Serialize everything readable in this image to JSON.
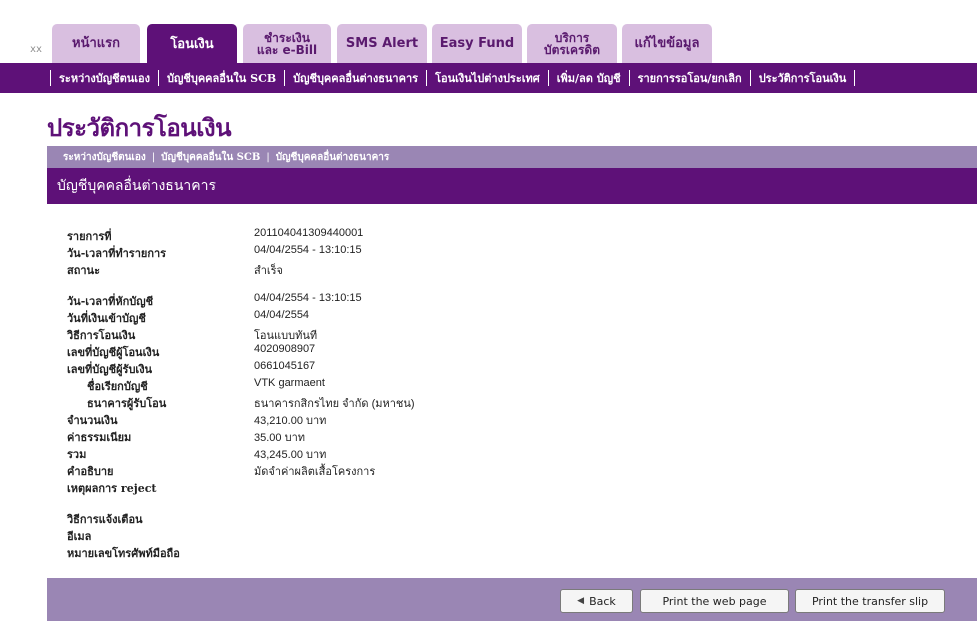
{
  "top_tabs": [
    {
      "label": "หน้าแรก"
    },
    {
      "label": "โอนเงิน"
    },
    {
      "label_line1": "ชำระเงิน",
      "label_line2": "และ e-Bill"
    },
    {
      "label": "SMS Alert"
    },
    {
      "label": "Easy Fund"
    },
    {
      "label_line1": "บริการ",
      "label_line2": "บัตรเครดิต"
    },
    {
      "label": "แก้ไขข้อมูล"
    }
  ],
  "top_left_marker": "xx",
  "submenu": [
    "ระหว่างบัญชีตนเอง",
    "บัญชีบุคคลอื่นใน SCB",
    "บัญชีบุคคลอื่นต่างธนาคาร",
    "โอนเงินไปต่างประเทศ",
    "เพิ่ม/ลด บัญชี",
    "รายการรอโอน/ยกเลิก",
    "ประวัติการโอนเงิน"
  ],
  "page_title": "ประวัติการโอนเงิน",
  "subnav": [
    "ระหว่างบัญชีตนเอง",
    "บัญชีบุคคลอื่นใน SCB",
    "บัญชีบุคคลอื่นต่างธนาคาร"
  ],
  "section_title": "บัญชีบุคคลอื่นต่างธนาคาร",
  "details": {
    "ref_label": "รายการที่",
    "ref_value": "201104041309440001",
    "txn_time_label": "วัน-เวลาที่ทำรายการ",
    "txn_time_value": "04/04/2554 - 13:10:15",
    "status_label": "สถานะ",
    "status_value": "สำเร็จ",
    "debit_time_label": "วัน-เวลาที่หักบัญชี",
    "debit_time_value": "04/04/2554 - 13:10:15",
    "credit_date_label": "วันที่เงินเข้าบัญชี",
    "credit_date_value": "04/04/2554",
    "method_label": "วิธีการโอนเงิน",
    "method_value": "โอนแบบทันที",
    "from_acct_label": "เลขที่บัญชีผู้โอนเงิน",
    "from_acct_value": "4020908907",
    "to_acct_label": "เลขที่บัญชีผู้รับเงิน",
    "to_acct_value": "0661045167",
    "acct_name_label": "ชื่อเรียกบัญชี",
    "acct_name_value": "VTK garmaent",
    "bank_label": "ธนาคารผู้รับโอน",
    "bank_value": "ธนาคารกสิกรไทย จำกัด (มหาชน)",
    "amount_label": "จำนวนเงิน",
    "amount_value": "43,210.00  บาท",
    "fee_label": "ค่าธรรมเนียม",
    "fee_value": "35.00  บาท",
    "total_label": "รวม",
    "total_value": "43,245.00  บาท",
    "desc_label": "คำอธิบาย",
    "desc_value": "มัดจำค่าผลิตเสื้อโครงการ",
    "reject_label": "เหตุผลการ reject",
    "reject_value": "",
    "notify_label": "วิธีการแจ้งเตือน",
    "notify_value": "",
    "email_label": "อีเมล",
    "email_value": "",
    "mobile_label": "หมายเลขโทรศัพท์มือถือ",
    "mobile_value": ""
  },
  "buttons": {
    "back": "Back",
    "print_page": "Print the web page",
    "print_slip": "Print the transfer slip"
  },
  "colors": {
    "brand_purple": "#5e1178",
    "tab_light": "#d9bfe0",
    "bar_lavender": "#9a86b4"
  }
}
